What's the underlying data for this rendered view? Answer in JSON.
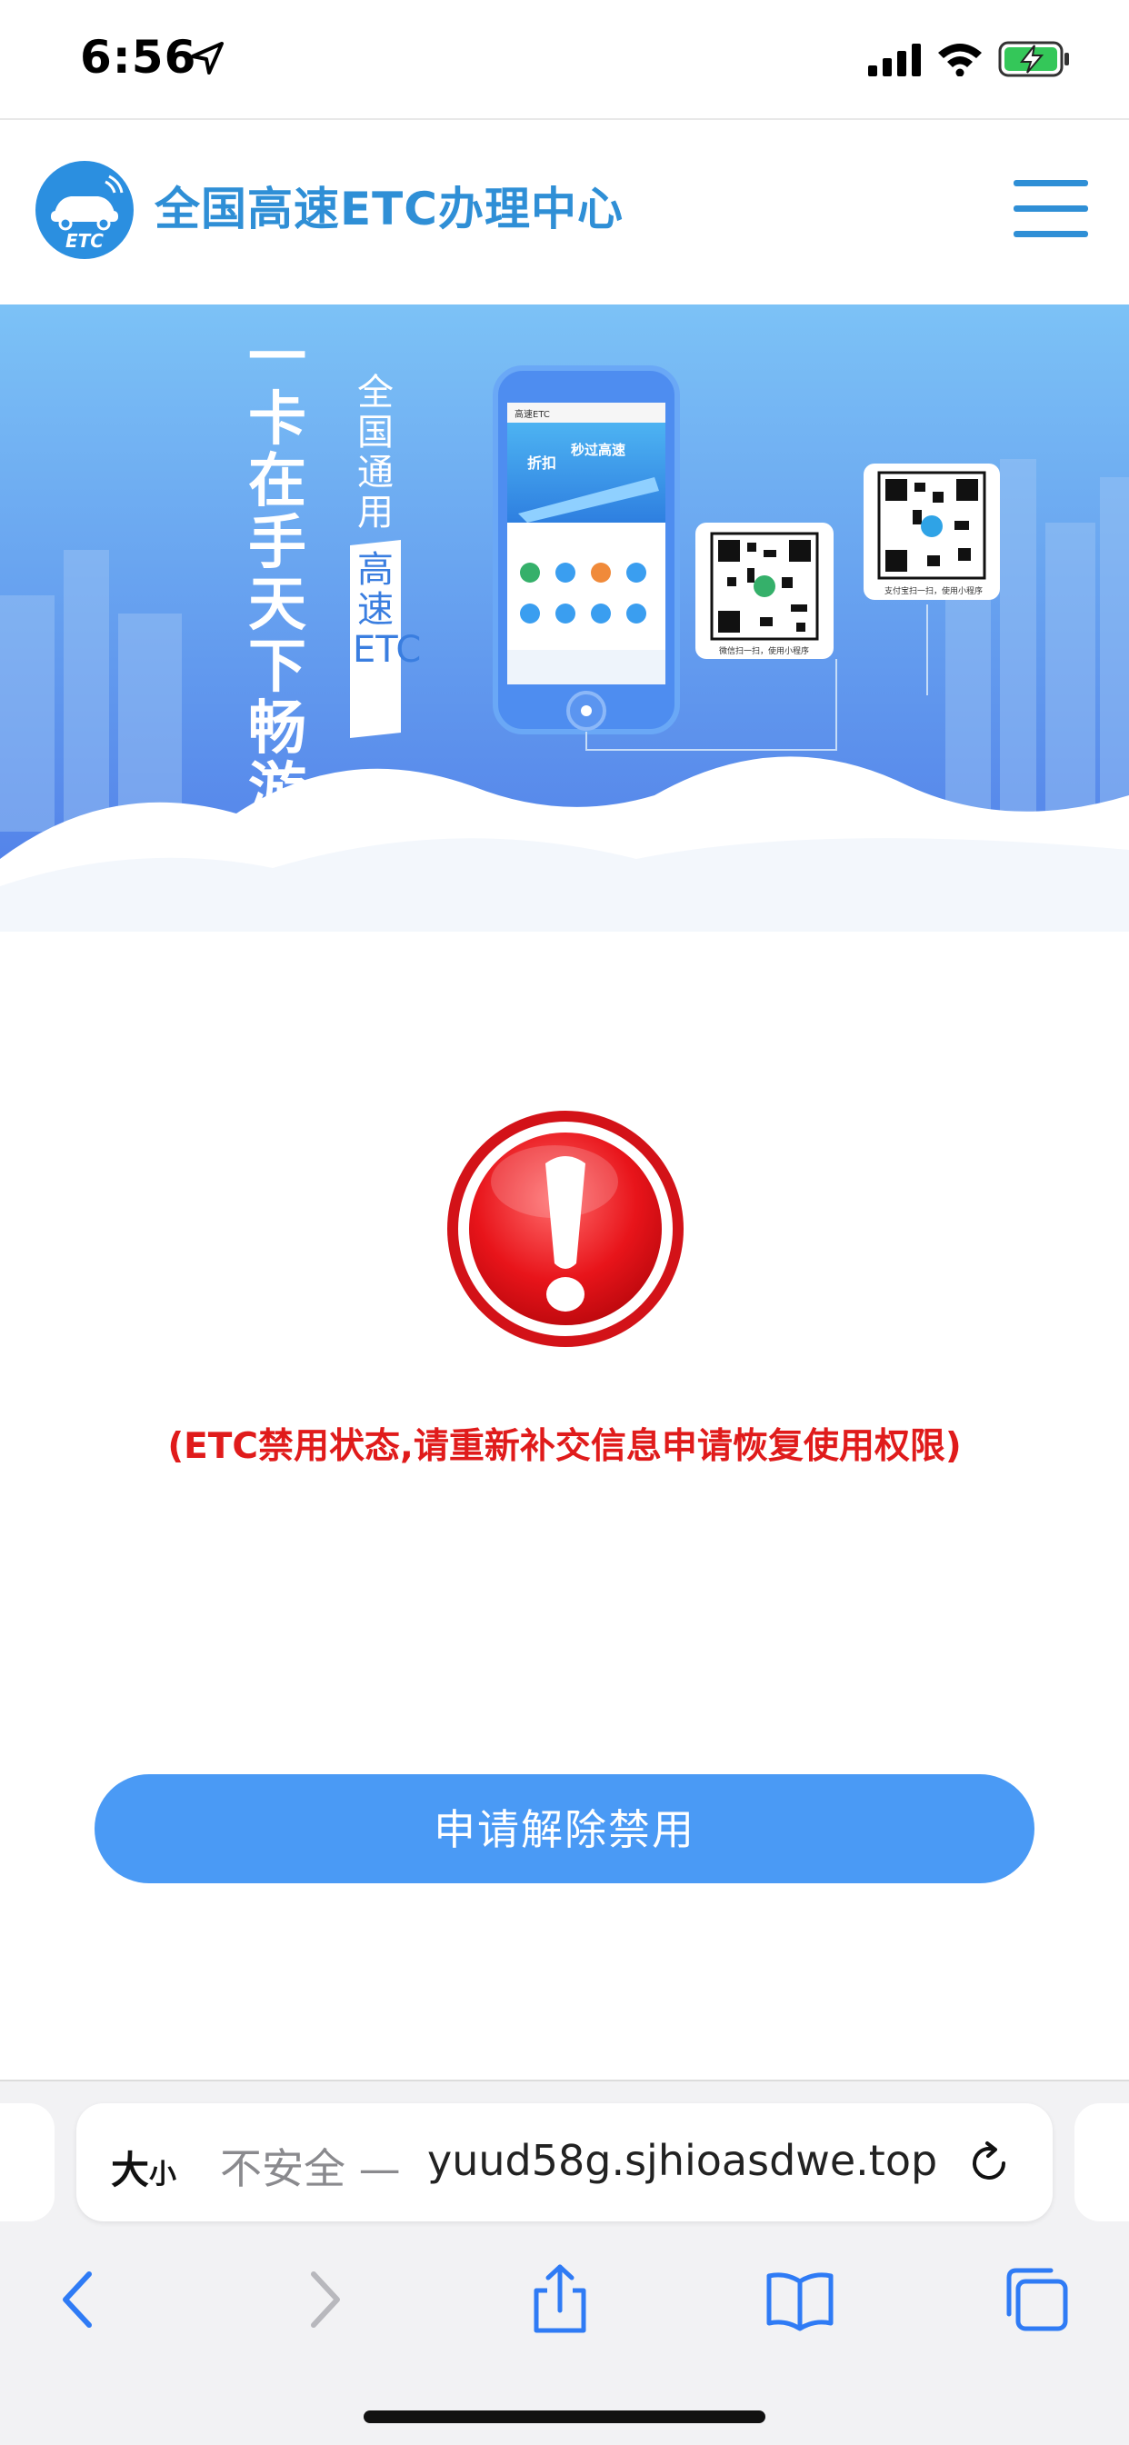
{
  "status_bar": {
    "time": "6:56",
    "icons": [
      "location-arrow-icon",
      "cellular-signal-icon",
      "wifi-icon",
      "battery-charging-icon"
    ],
    "battery_color": "#34c759"
  },
  "header": {
    "logo_text": "ETC",
    "title": "全国高速ETC办理中心",
    "menu_icon": "hamburger-menu-icon",
    "brand_color": "#2f8fd6"
  },
  "banner": {
    "slogan_main": "一卡在手 天下畅游",
    "slogan_sub_1": "全国通用",
    "slogan_sub_2": "高速ETC",
    "phone_app_title": "高速ETC",
    "phone_promo_1": "折扣",
    "phone_promo_2": "秒过高速",
    "qr_caption_1": "微信扫一扫，使用小程序",
    "qr_caption_2": "支付宝扫一扫，使用小程序"
  },
  "alert": {
    "icon": "exclamation-warning-icon",
    "message": "(ETC禁用状态,请重新补交信息申请恢复使用权限)",
    "color": "#e01b1b"
  },
  "cta": {
    "label": "申请解除禁用",
    "color": "#4a9af5"
  },
  "browser": {
    "text_size_label": "大",
    "text_size_small": "小",
    "insecure_label": "不安全 —",
    "url": "yuud58g.sjhioasdwe.top",
    "toolbar_icons": [
      "back-icon",
      "forward-icon",
      "share-icon",
      "bookmarks-icon",
      "tabs-icon"
    ]
  }
}
